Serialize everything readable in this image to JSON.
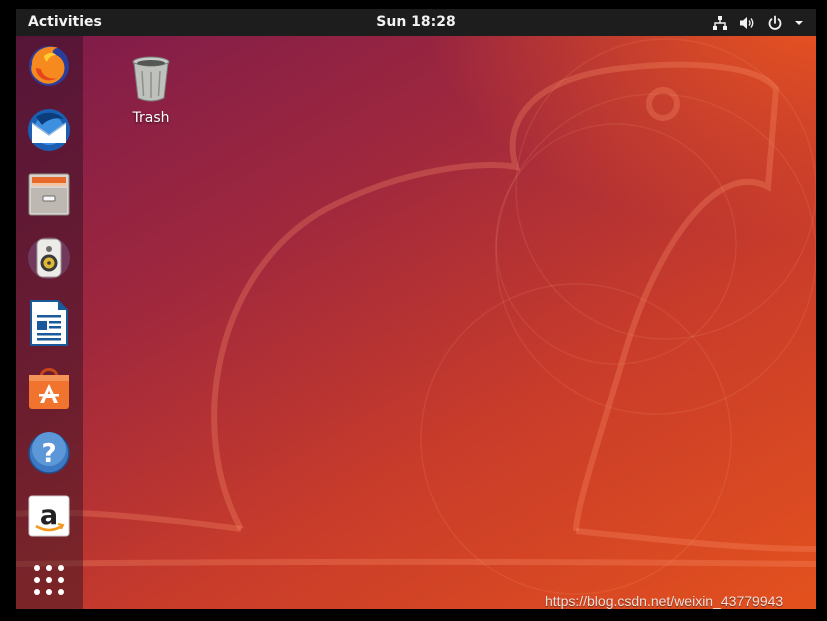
{
  "topbar": {
    "activities_label": "Activities",
    "clock": "Sun 18:28",
    "tray_icons": [
      "network-icon",
      "volume-icon",
      "power-icon",
      "chevron-down-icon"
    ]
  },
  "dock": {
    "items": [
      {
        "name": "Firefox",
        "icon": "firefox-icon"
      },
      {
        "name": "Thunderbird",
        "icon": "thunderbird-icon"
      },
      {
        "name": "Files",
        "icon": "files-icon"
      },
      {
        "name": "Rhythmbox",
        "icon": "rhythmbox-icon"
      },
      {
        "name": "LibreOffice Writer",
        "icon": "writer-icon"
      },
      {
        "name": "Ubuntu Software",
        "icon": "software-icon"
      },
      {
        "name": "Help",
        "icon": "help-icon"
      },
      {
        "name": "Amazon",
        "icon": "amazon-icon"
      },
      {
        "name": "Show Applications",
        "icon": "app-grid-icon"
      }
    ]
  },
  "desktop": {
    "trash_label": "Trash"
  },
  "watermark": "https://blog.csdn.net/weixin_43779943",
  "colors": {
    "topbar": "#1d1d1d",
    "wallpaper_orange": "#e3511e",
    "wallpaper_purple": "#7a1a4c"
  }
}
